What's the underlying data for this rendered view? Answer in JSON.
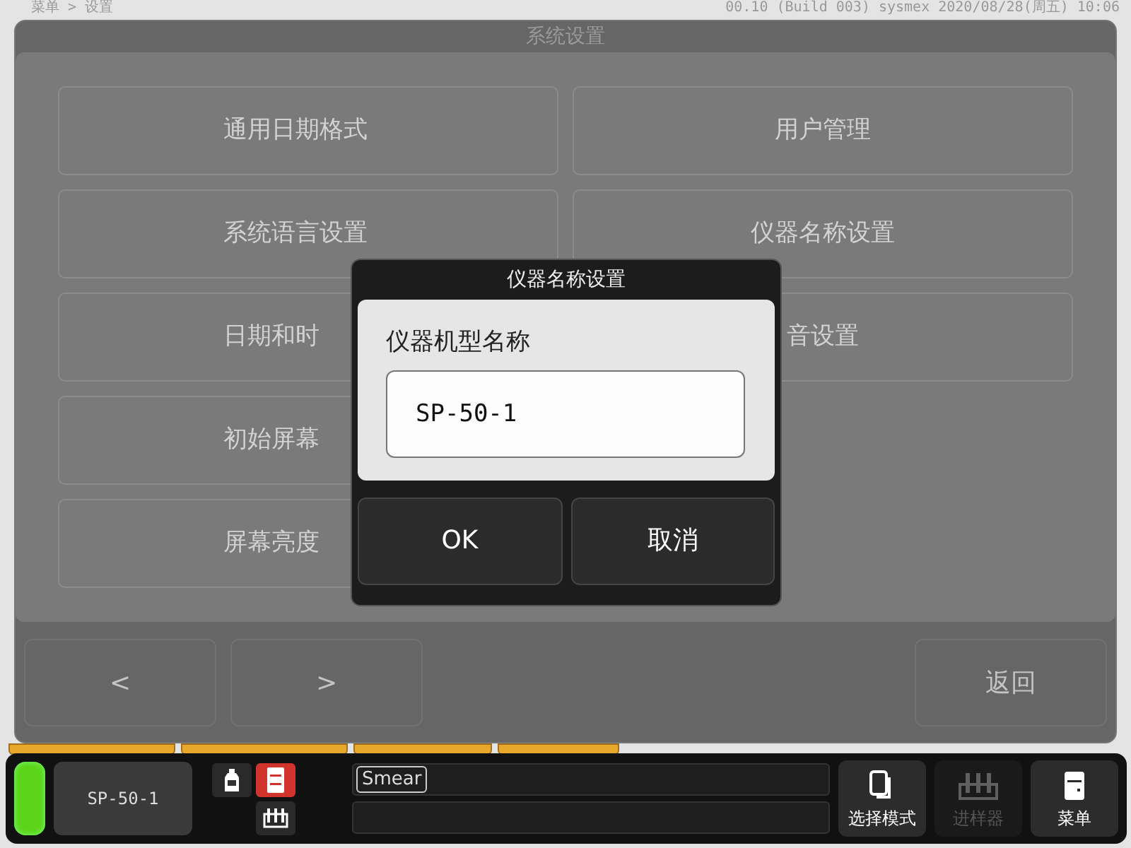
{
  "header": {
    "breadcrumb": "菜单 > 设置",
    "info": "00.10 (Build 003) sysmex 2020/08/28(周五) 10:06"
  },
  "settings_dialog": {
    "title": "系统设置",
    "left_options": [
      {
        "label": "通用日期格式"
      },
      {
        "label": "系统语言设置"
      },
      {
        "label": "日期和时"
      },
      {
        "label": "初始屏幕"
      },
      {
        "label": "屏幕亮度"
      }
    ],
    "right_options": [
      {
        "label": "用户管理"
      },
      {
        "label": "仪器名称设置"
      },
      {
        "label": "音设置"
      }
    ],
    "nav_buttons": [
      "<",
      ">"
    ],
    "back_button": "返回"
  },
  "name_dialog": {
    "title": "仪器名称设置",
    "field_label": "仪器机型名称",
    "value": "SP-50-1",
    "buttons": [
      "OK",
      "取消"
    ]
  },
  "status_bar": {
    "device": "SP-50-1",
    "icons": [
      {
        "kind": "bottle",
        "active": false
      },
      {
        "kind": "cabinet",
        "active": true
      },
      {
        "kind": "rack",
        "active": false
      }
    ],
    "mode_tag": "Smear",
    "actions": [
      {
        "kind": "mode",
        "label": "选择模式",
        "disabled": false
      },
      {
        "kind": "rack",
        "label": "进样器",
        "disabled": true
      },
      {
        "kind": "menu",
        "label": "菜单",
        "disabled": false
      }
    ]
  }
}
